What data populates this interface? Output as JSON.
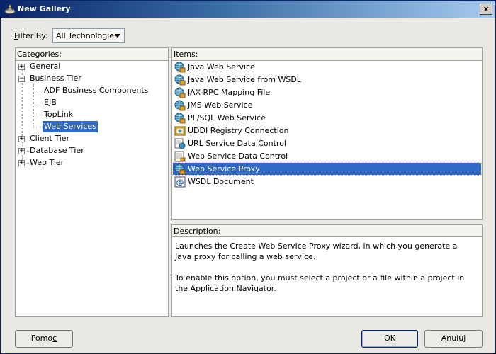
{
  "window": {
    "title": "New Gallery",
    "close_label": "x"
  },
  "filter": {
    "label": "Filter By:",
    "value": "All Technologies"
  },
  "categories": {
    "header": "Categories:",
    "tree": [
      {
        "label": "General",
        "expander": "+"
      },
      {
        "label": "Business Tier",
        "expander": "−",
        "children": [
          "ADF Business Components",
          "EJB",
          "TopLink",
          "Web Services"
        ]
      },
      {
        "label": "Client Tier",
        "expander": "+"
      },
      {
        "label": "Database Tier",
        "expander": "+"
      },
      {
        "label": "Web Tier",
        "expander": "+"
      }
    ],
    "selected": "Web Services"
  },
  "items": {
    "header": "Items:",
    "list": [
      {
        "label": "Java Web Service",
        "icon": "web-service-icon"
      },
      {
        "label": "Java Web Service from WSDL",
        "icon": "web-service-icon"
      },
      {
        "label": "JAX-RPC Mapping File",
        "icon": "web-service-icon"
      },
      {
        "label": "JMS Web Service",
        "icon": "web-service-icon"
      },
      {
        "label": "PL/SQL Web Service",
        "icon": "web-service-icon"
      },
      {
        "label": "UDDI Registry Connection",
        "icon": "uddi-registry-icon"
      },
      {
        "label": "URL Service Data Control",
        "icon": "url-data-control-icon"
      },
      {
        "label": "Web Service Data Control",
        "icon": "data-control-icon"
      },
      {
        "label": "Web Service Proxy",
        "icon": "web-service-icon"
      },
      {
        "label": "WSDL Document",
        "icon": "wsdl-document-icon"
      }
    ],
    "selected": "Web Service Proxy"
  },
  "description": {
    "header": "Description:",
    "text1": "Launches the Create Web Service Proxy wizard, in which you generate a Java proxy for calling a web service.",
    "text2": "To enable this option, you must select a project or a file within a project in the Application Navigator."
  },
  "buttons": {
    "help": "Pomoc",
    "ok": "OK",
    "cancel": "Anuluj"
  }
}
